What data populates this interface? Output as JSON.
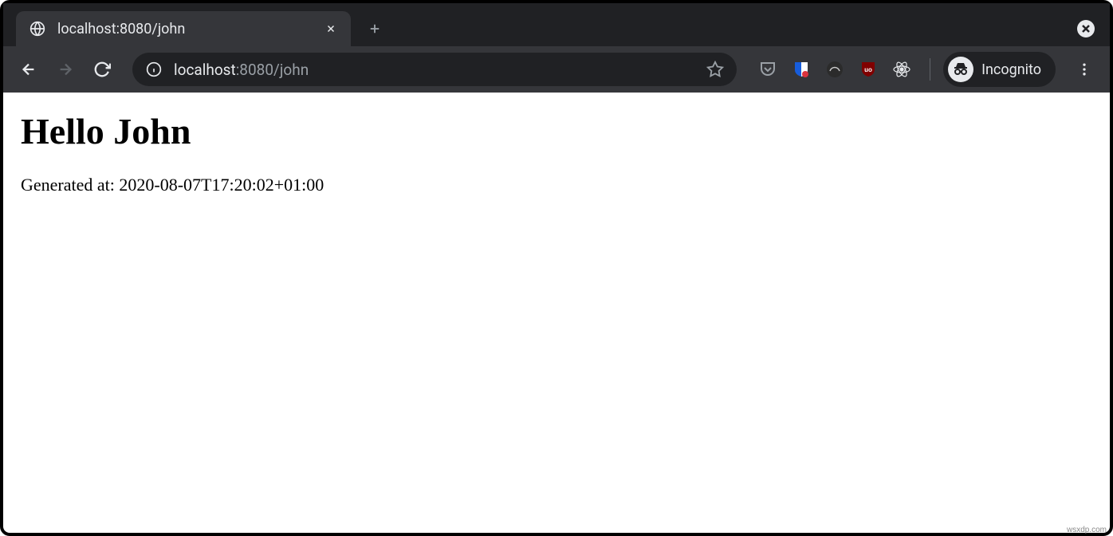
{
  "tab": {
    "title": "localhost:8080/john"
  },
  "address": {
    "host": "localhost",
    "path": ":8080/john"
  },
  "incognito": {
    "label": "Incognito"
  },
  "page": {
    "heading": "Hello John",
    "generated_text": "Generated at: 2020-08-07T17:20:02+01:00"
  },
  "watermark": "wsxdp.com"
}
